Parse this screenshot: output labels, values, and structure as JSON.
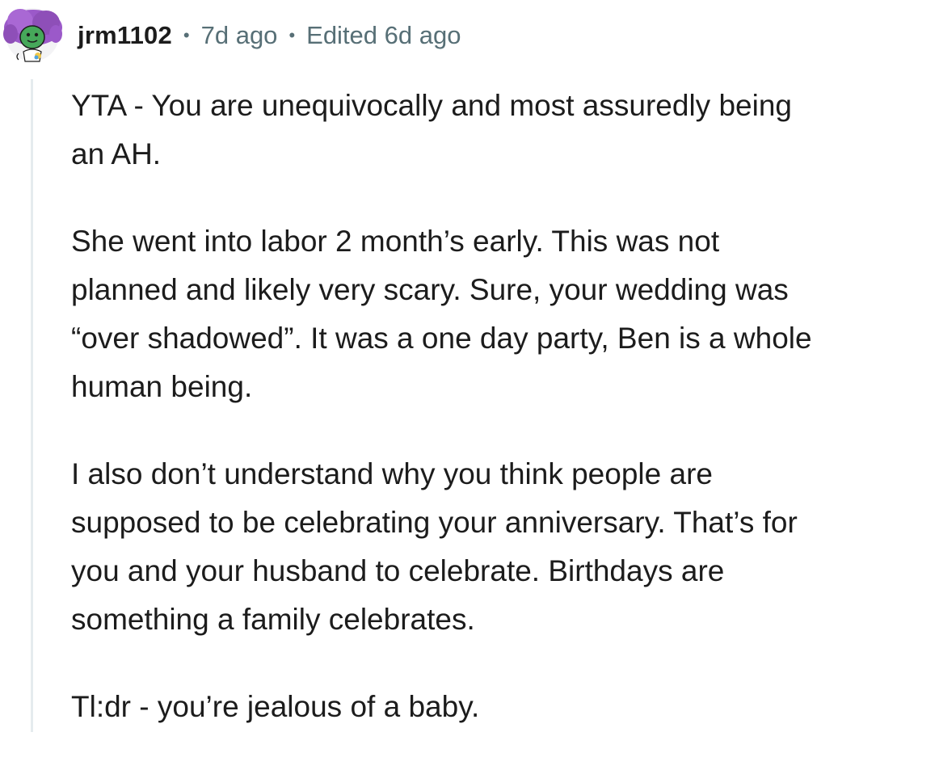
{
  "comment": {
    "username": "jrm1102",
    "separator": "•",
    "timestamp": "7d ago",
    "edited": "Edited 6d ago",
    "avatar_icon": "snoo-avatar-icon",
    "paragraphs": [
      [
        "YTA - You are unequivocally and most assuredly being",
        "an AH."
      ],
      [
        "She went into labor 2 month’s early. This was not",
        "planned and likely very scary. Sure, your wedding was",
        "“over shadowed”. It was a one day party, Ben is a whole",
        "human being."
      ],
      [
        "I also don’t understand why you think people are",
        "supposed to be celebrating your anniversary. That’s for",
        "you and your husband to celebrate. Birthdays are",
        "something a family celebrates."
      ],
      [
        "Tl:dr - you’re jealous of a baby."
      ]
    ]
  },
  "colors": {
    "meta": "#576f76",
    "text": "#1c1c1c",
    "thread_line": "#e5ebee",
    "avatar_purple": "#8e4fb8",
    "avatar_green": "#46a85a"
  }
}
